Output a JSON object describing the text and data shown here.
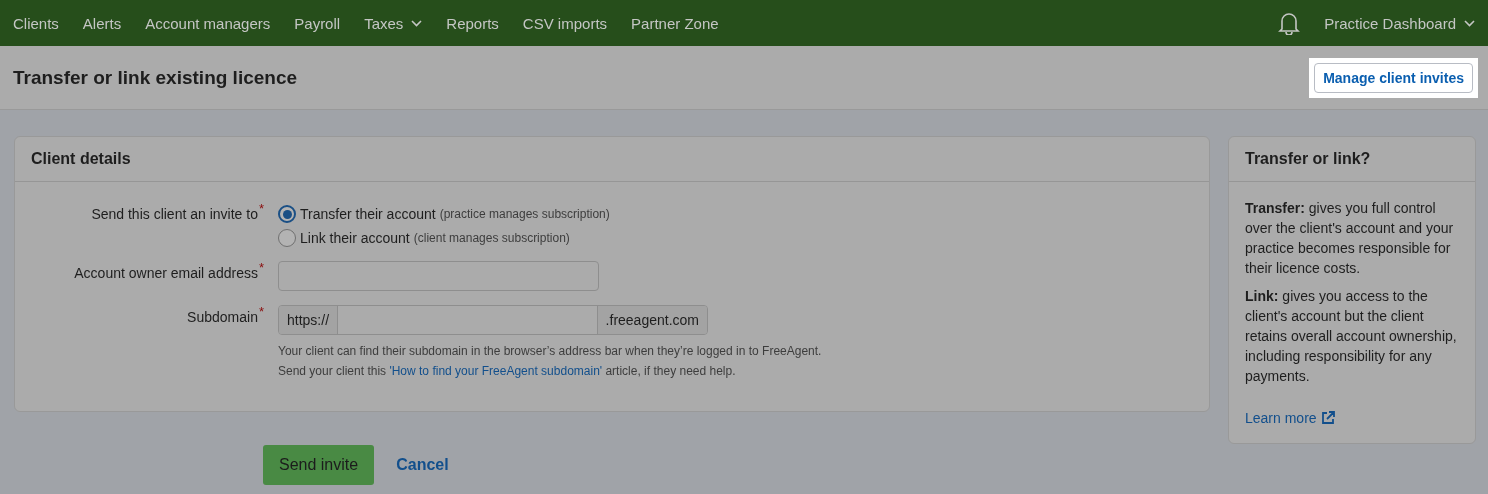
{
  "nav": {
    "items": [
      {
        "label": "Clients",
        "dropdown": false
      },
      {
        "label": "Alerts",
        "dropdown": false
      },
      {
        "label": "Account managers",
        "dropdown": false
      },
      {
        "label": "Payroll",
        "dropdown": false
      },
      {
        "label": "Taxes",
        "dropdown": true
      },
      {
        "label": "Reports",
        "dropdown": false
      },
      {
        "label": "CSV imports",
        "dropdown": false
      },
      {
        "label": "Partner Zone",
        "dropdown": false
      }
    ],
    "account": "Practice Dashboard"
  },
  "header": {
    "title": "Transfer or link existing licence",
    "button": "Manage client invites"
  },
  "form": {
    "title": "Client details",
    "fields": [
      {
        "kind": "radio",
        "label": "Send this client an invite to",
        "required_mark": "*",
        "options": [
          {
            "label": "Transfer their account",
            "note": "(practice manages subscription)",
            "selected": true
          },
          {
            "label": "Link their account",
            "note": "(client manages subscription)",
            "selected": false
          }
        ]
      },
      {
        "kind": "email",
        "label": "Account owner email address",
        "required_mark": "*"
      },
      {
        "kind": "subdomain",
        "label": "Subdomain",
        "required_mark": "*",
        "prefix": "https://",
        "suffix": ".freeagent.com",
        "help": [
          "Your client can find their subdomain in the browser’s address bar when they’re logged in to FreeAgent."
        ],
        "help_link": {
          "before": "Send your client this ",
          "link": "'How to find your FreeAgent subdomain'",
          "after": " article, if they need help."
        }
      }
    ],
    "submit": "Send invite",
    "cancel": "Cancel"
  },
  "sidebar": {
    "title": "Transfer or link?",
    "paragraphs": [
      "**Transfer:** gives you full control over the client's account and your practice becomes responsible for their licence costs.",
      "**Link:** gives you access to the client's account but the client retains overall account ownership, including responsibility for any payments."
    ],
    "link": "Learn more"
  }
}
